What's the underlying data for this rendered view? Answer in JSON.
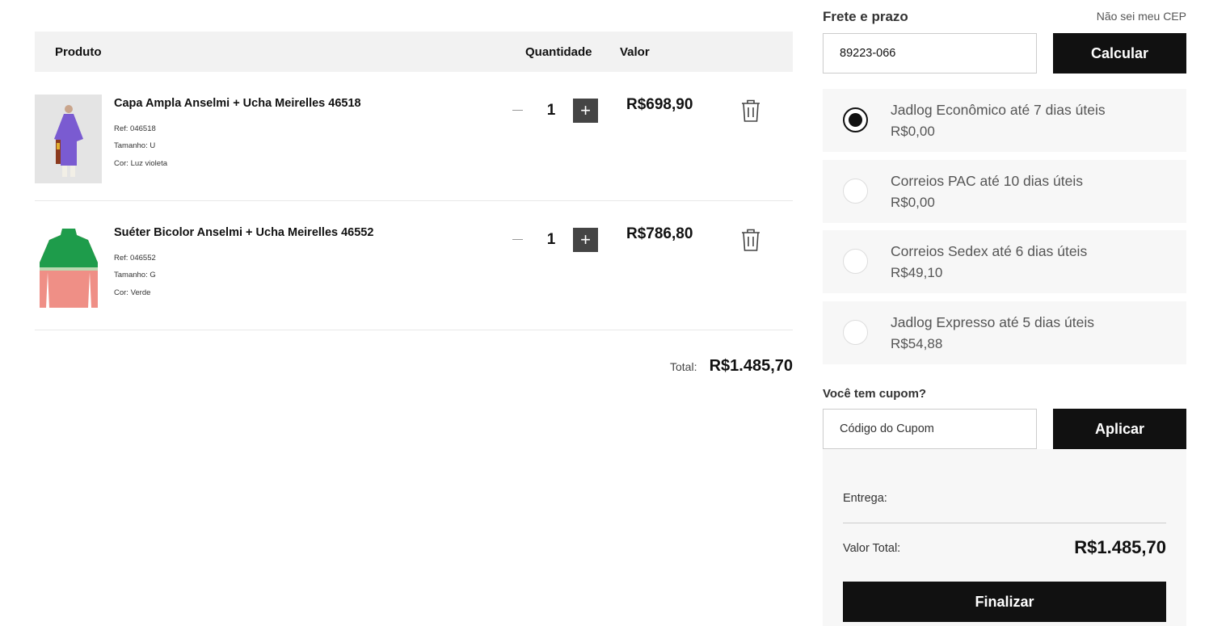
{
  "cart": {
    "headers": {
      "product": "Produto",
      "quantity": "Quantidade",
      "value": "Valor"
    },
    "items": [
      {
        "name": "Capa Ampla Anselmi + Ucha Meirelles 46518",
        "ref": "Ref: 046518",
        "size": "Tamanho:  U",
        "color": "Cor:  Luz violeta",
        "quantity": "1",
        "price": "R$698,90",
        "image": "purple-cape-model-photo"
      },
      {
        "name": "Suéter Bicolor Anselmi + Ucha Meirelles 46552",
        "ref": "Ref: 046552",
        "size": "Tamanho:  G",
        "color": "Cor:  Verde",
        "quantity": "1",
        "price": "R$786,80",
        "image": "green-pink-sweater-photo"
      }
    ],
    "total_label": "Total:",
    "total_value": "R$1.485,70"
  },
  "shipping": {
    "title": "Frete e prazo",
    "cep_link": "Não sei meu CEP",
    "cep_value": "89223-066",
    "calc_button": "Calcular",
    "options": [
      {
        "name": "Jadlog Econômico até 7 dias úteis",
        "price": "R$0,00",
        "selected": true
      },
      {
        "name": "Correios PAC até 10 dias úteis",
        "price": "R$0,00",
        "selected": false
      },
      {
        "name": "Correios Sedex até 6 dias úteis",
        "price": "R$49,10",
        "selected": false
      },
      {
        "name": "Jadlog Expresso até 5 dias úteis",
        "price": "R$54,88",
        "selected": false
      }
    ]
  },
  "coupon": {
    "title": "Você tem cupom?",
    "placeholder": "Código do Cupom",
    "apply_button": "Aplicar"
  },
  "summary": {
    "delivery_label": "Entrega:",
    "total_label": "Valor Total:",
    "total_value": "R$1.485,70",
    "finish_button": "Finalizar"
  },
  "colors": {
    "dark_button": "#111111",
    "header_bg": "#f2f2f2",
    "panel_bg": "#f7f7f7",
    "qty_plus_bg": "#444444"
  },
  "icons": {
    "trash": "trash-icon",
    "plus": "plus-icon",
    "minus": "minus-icon"
  }
}
